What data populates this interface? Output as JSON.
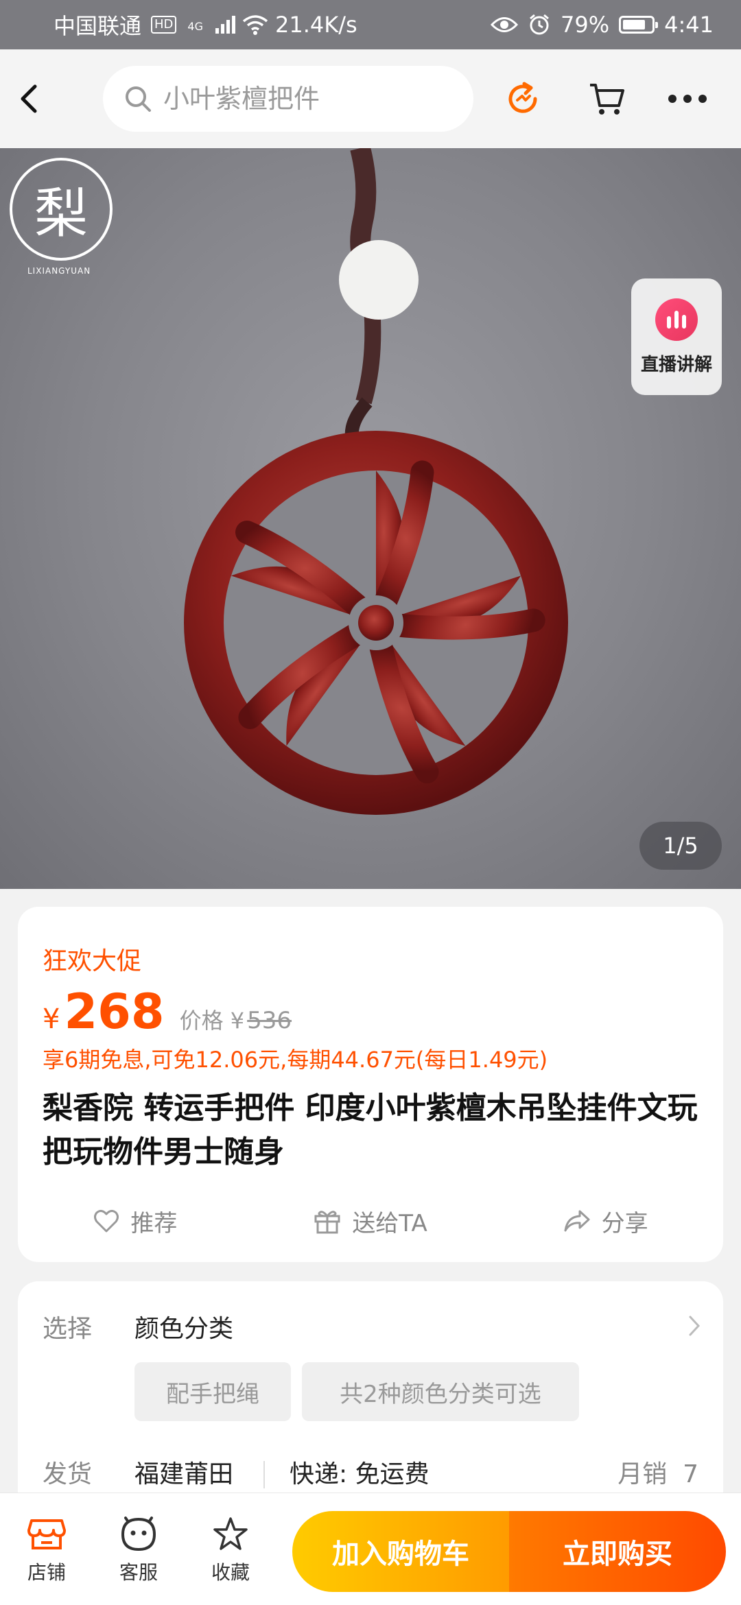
{
  "status_bar": {
    "carrier": "中国联通",
    "hd": "HD",
    "network": "4G",
    "speed": "21.4K/s",
    "battery": "79%",
    "battery_level": 0.79,
    "time": "4:41"
  },
  "nav": {
    "search_placeholder": "小叶紫檀把件",
    "icons": [
      "back-icon",
      "search-icon",
      "refresh-icon",
      "cart-icon",
      "more-icon"
    ]
  },
  "hero": {
    "brand_mark": "梨",
    "brand_name": "LIXIANGYUAN",
    "live_label": "直播讲解",
    "page_indicator": "1/5",
    "background_color": "#85858b",
    "pendant_color": "#8c1f1c"
  },
  "product": {
    "promo_label": "狂欢大促",
    "currency": "¥",
    "price": "268",
    "original_label": "价格 ¥",
    "original_price": "536",
    "installment": "享6期免息,可免12.06元,每期44.67元(每日1.49元)",
    "title": "梨香院 转运手把件 印度小叶紫檀木吊坠挂件文玩把玩物件男士随身",
    "actions": [
      {
        "icon": "heart-icon",
        "label": "推荐"
      },
      {
        "icon": "gift-icon",
        "label": "送给TA"
      },
      {
        "icon": "share-icon",
        "label": "分享"
      }
    ],
    "accent_color": "#ff5000"
  },
  "options": {
    "select_label": "选择",
    "select_value": "颜色分类",
    "chips": [
      "配手把绳",
      "共2种颜色分类可选"
    ],
    "ship_label": "发货",
    "ship_origin": "福建莆田",
    "ship_method": "快递: 免运费",
    "monthly_sales": "月销  7"
  },
  "bottom_bar": {
    "tabs": [
      {
        "icon": "store-icon",
        "label": "店铺"
      },
      {
        "icon": "service-icon",
        "label": "客服"
      },
      {
        "icon": "star-icon",
        "label": "收藏"
      }
    ],
    "add_to_cart": "加入购物车",
    "buy_now": "立即购买"
  }
}
